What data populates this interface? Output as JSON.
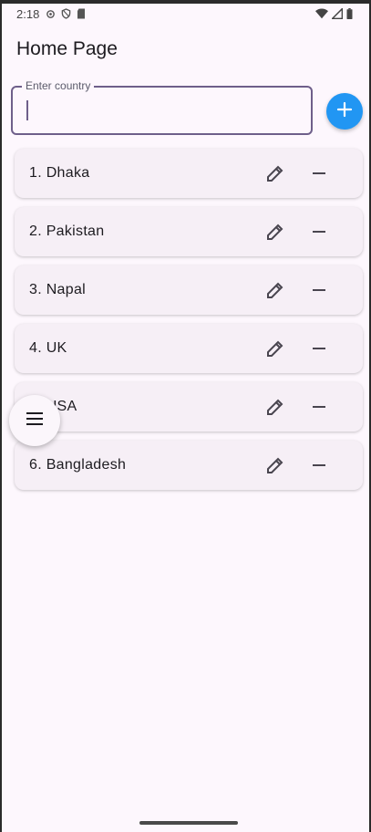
{
  "status_bar": {
    "time": "2:18",
    "left_icons": [
      "settings-icon",
      "shield-icon",
      "sd-card-icon"
    ],
    "right_icons": [
      "wifi-icon",
      "signal-icon",
      "battery-icon"
    ]
  },
  "app_bar": {
    "title": "Home Page"
  },
  "input": {
    "label": "Enter country",
    "value": ""
  },
  "add_button": {
    "icon": "plus-icon",
    "color": "#2196f3"
  },
  "countries": [
    {
      "label": "1. Dhaka"
    },
    {
      "label": "2. Pakistan"
    },
    {
      "label": "3. Napal"
    },
    {
      "label": "4. UK"
    },
    {
      "label": "5. USA"
    },
    {
      "label": "6. Bangladesh"
    }
  ],
  "row_actions": {
    "edit_icon": "pencil-icon",
    "remove_icon": "minus-icon"
  },
  "menu_fab": {
    "icon": "menu-icon"
  }
}
